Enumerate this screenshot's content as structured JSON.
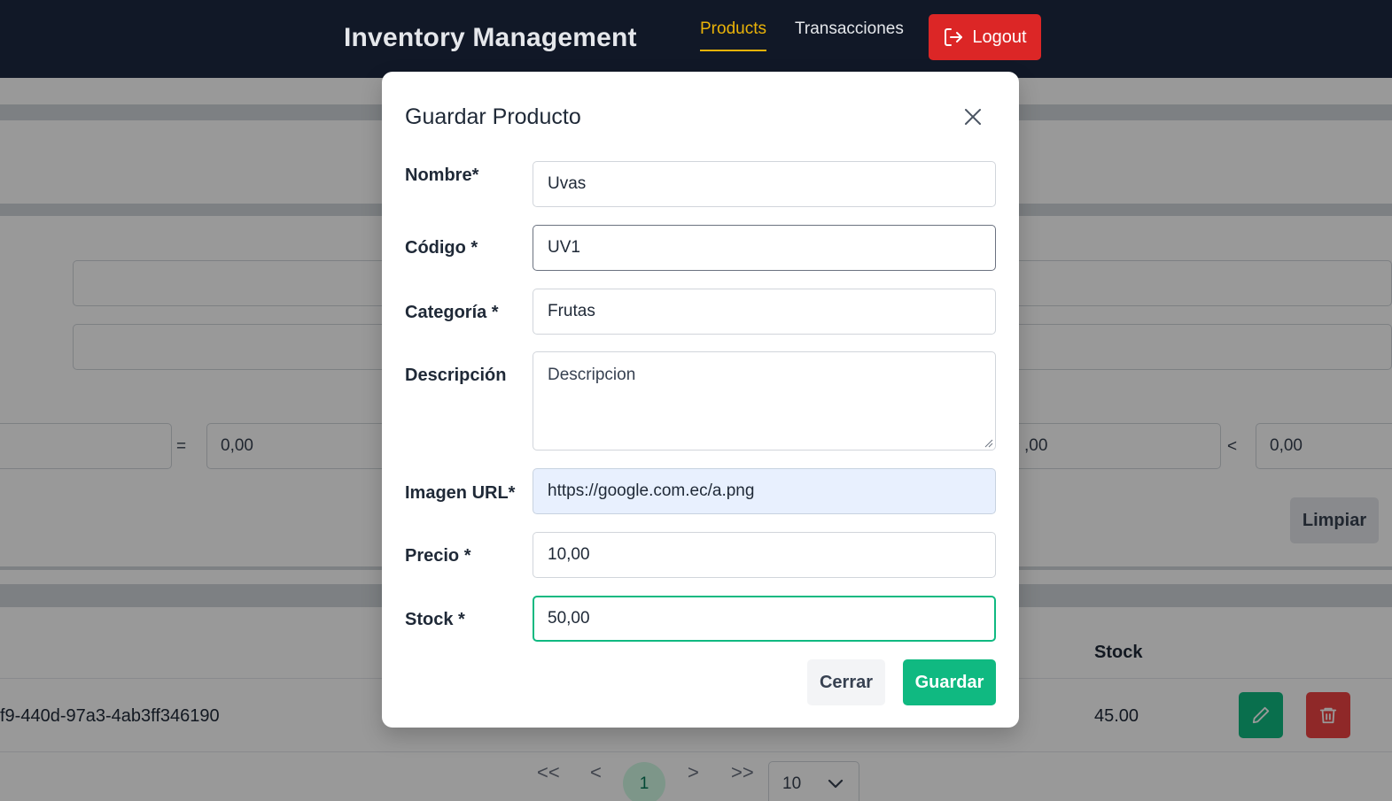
{
  "app": {
    "title": "Inventory Management"
  },
  "nav": {
    "products_label": "Products",
    "transactions_label": "Transacciones",
    "logout_label": "Logout"
  },
  "background": {
    "filter_value_1": "0,00",
    "filter_value_2": ",00",
    "filter_value_3": "0,00",
    "eq_operator": "=",
    "lt_operator": "<",
    "clear_button": "Limpiar",
    "table": {
      "stock_header": "Stock",
      "rows": [
        {
          "id": "f9-440d-97a3-4ab3ff346190",
          "stock": "45.00"
        }
      ]
    },
    "pagination": {
      "first": "<<",
      "prev": "<",
      "current": "1",
      "next": ">",
      "last": ">>",
      "page_size": "10"
    }
  },
  "modal": {
    "title": "Guardar Producto",
    "fields": {
      "nombre": {
        "label": "Nombre*",
        "value": "Uvas"
      },
      "codigo": {
        "label": "Código *",
        "value": "UV1"
      },
      "categoria": {
        "label": "Categoría *",
        "value": "Frutas"
      },
      "descripcion": {
        "label": "Descripción",
        "value": "Descripcion"
      },
      "imagen": {
        "label": "Imagen URL*",
        "value": "https://google.com.ec/a.png"
      },
      "precio": {
        "label": "Precio *",
        "value": "10,00"
      },
      "stock": {
        "label": "Stock *",
        "value": "50,00"
      }
    },
    "close_button": "Cerrar",
    "save_button": "Guardar"
  },
  "colors": {
    "navbar": "#111827",
    "accent_active_nav": "#eab308",
    "danger": "#dc2626",
    "success": "#10b981"
  },
  "icons": [
    "logout-icon",
    "close-icon",
    "pencil-icon",
    "trash-icon",
    "chevron-down-icon"
  ]
}
